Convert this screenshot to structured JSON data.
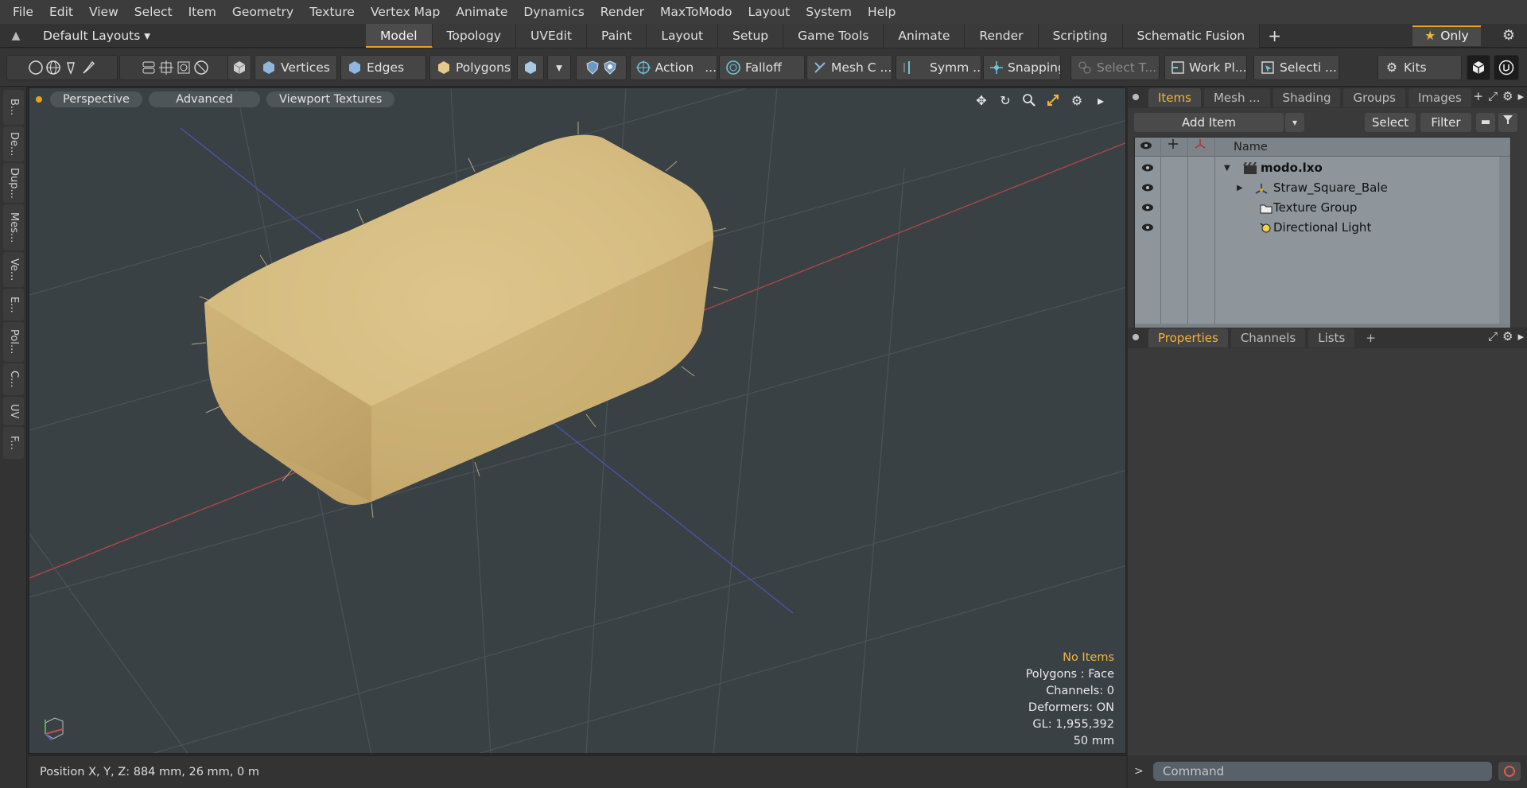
{
  "menubar": [
    "File",
    "Edit",
    "View",
    "Select",
    "Item",
    "Geometry",
    "Texture",
    "Vertex Map",
    "Animate",
    "Dynamics",
    "Render",
    "MaxToModo",
    "Layout",
    "System",
    "Help"
  ],
  "layoutbar": {
    "layouts_label": "Default Layouts",
    "tabs": [
      "Model",
      "Topology",
      "UVEdit",
      "Paint",
      "Layout",
      "Setup",
      "Game Tools",
      "Animate",
      "Render",
      "Scripting",
      "Schematic Fusion"
    ],
    "active_tab": "Model",
    "only_label": "Only"
  },
  "toolbar": {
    "vertices": "Vertices",
    "edges": "Edges",
    "polygons": "Polygons",
    "action": "Action",
    "falloff": "Falloff",
    "mesh_c": "Mesh C ...",
    "symm": "Symm ...",
    "snapping": "Snapping",
    "select_t": "Select T...",
    "work_pl": "Work Pl...",
    "selecti": "Selecti ...",
    "kits": "Kits"
  },
  "left_tabs": [
    "B...",
    "De...",
    "Dup...",
    "Mes...",
    "Ve...",
    "E...",
    "Pol...",
    "C...",
    "UV",
    "F..."
  ],
  "viewport": {
    "perspective": "Perspective",
    "advanced": "Advanced",
    "viewport_textures": "Viewport Textures",
    "info": {
      "no_items": "No Items",
      "polygons": "Polygons : Face",
      "channels": "Channels: 0",
      "deformers": "Deformers: ON",
      "gl": "GL: 1,955,392",
      "scale": "50 mm"
    }
  },
  "statusbar": {
    "position": "Position X, Y, Z:   884 mm, 26 mm, 0 m"
  },
  "items_panel": {
    "tabs": [
      "Items",
      "Mesh ...",
      "Shading",
      "Groups",
      "Images"
    ],
    "active_tab": "Items",
    "add_item": "Add Item",
    "select": "Select",
    "filter": "Filter",
    "name_header": "Name",
    "items": [
      {
        "name": "modo.lxo",
        "bold": true,
        "icon": "scene-icon"
      },
      {
        "name": "Straw_Square_Bale",
        "bold": false,
        "icon": "mesh-locator-icon"
      },
      {
        "name": "Texture Group",
        "bold": false,
        "icon": "texture-group-icon"
      },
      {
        "name": "Directional Light",
        "bold": false,
        "icon": "light-icon"
      }
    ]
  },
  "properties_panel": {
    "tabs": [
      "Properties",
      "Channels",
      "Lists"
    ],
    "active_tab": "Properties"
  },
  "command": {
    "placeholder": "Command"
  },
  "colors": {
    "accent": "#e8a21e",
    "viewport_bg": "#3a4145",
    "item_list_bg": "#8e969c",
    "straw": "#d6be83"
  }
}
